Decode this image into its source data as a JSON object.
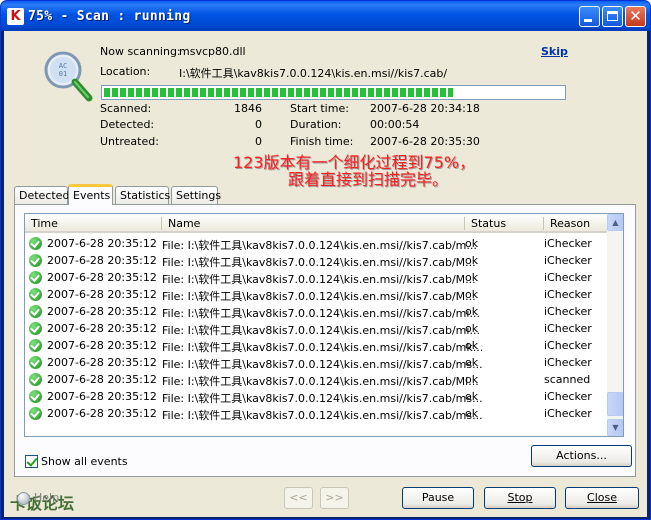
{
  "window": {
    "title": "75% - Scan : running",
    "title_icon_letter": "K"
  },
  "scan": {
    "now_scanning_label": "Now scanning:",
    "now_scanning_value": "msvcp80.dll",
    "location_label": "Location:",
    "location_value": "I:\\软件工具\\kav8kis7.0.0.124\\kis.en.msi//kis7.cab/",
    "skip_label": "Skip",
    "progress_fraction": 0.76,
    "stats": {
      "scanned_label": "Scanned:",
      "scanned_value": "1846",
      "detected_label": "Detected:",
      "detected_value": "0",
      "untreated_label": "Untreated:",
      "untreated_value": "0",
      "start_label": "Start time:",
      "start_value": "2007-6-28 20:34:18",
      "duration_label": "Duration:",
      "duration_value": "00:00:54",
      "finish_label": "Finish time:",
      "finish_value": "2007-6-28 20:35:30"
    },
    "annotation_line1": "123版本有一个细化过程到75%，",
    "annotation_line2": "跟着直接到扫描完毕。"
  },
  "tabs": [
    "Detected",
    "Events",
    "Statistics",
    "Settings"
  ],
  "active_tab": "Events",
  "events": {
    "columns": [
      "Time",
      "Name",
      "Status",
      "Reason"
    ],
    "rows": [
      {
        "time": "2007-6-28 20:35:12",
        "name": "File: I:\\软件工具\\kav8kis7.0.0.124\\kis.en.msi//kis7.cab/m...",
        "status": "ok",
        "reason": "iChecker"
      },
      {
        "time": "2007-6-28 20:35:12",
        "name": "File: I:\\软件工具\\kav8kis7.0.0.124\\kis.en.msi//kis7.cab/M...",
        "status": "ok",
        "reason": "iChecker"
      },
      {
        "time": "2007-6-28 20:35:12",
        "name": "File: I:\\软件工具\\kav8kis7.0.0.124\\kis.en.msi//kis7.cab/M...",
        "status": "ok",
        "reason": "iChecker"
      },
      {
        "time": "2007-6-28 20:35:12",
        "name": "File: I:\\软件工具\\kav8kis7.0.0.124\\kis.en.msi//kis7.cab/M...",
        "status": "ok",
        "reason": "iChecker"
      },
      {
        "time": "2007-6-28 20:35:12",
        "name": "File: I:\\软件工具\\kav8kis7.0.0.124\\kis.en.msi//kis7.cab/mi...",
        "status": "ok",
        "reason": "iChecker"
      },
      {
        "time": "2007-6-28 20:35:12",
        "name": "File: I:\\软件工具\\kav8kis7.0.0.124\\kis.en.msi//kis7.cab/mi...",
        "status": "ok",
        "reason": "iChecker"
      },
      {
        "time": "2007-6-28 20:35:12",
        "name": "File: I:\\软件工具\\kav8kis7.0.0.124\\kis.en.msi//kis7.cab/mk...",
        "status": "ok",
        "reason": "iChecker"
      },
      {
        "time": "2007-6-28 20:35:12",
        "name": "File: I:\\软件工具\\kav8kis7.0.0.124\\kis.en.msi//kis7.cab/ms...",
        "status": "ok",
        "reason": "iChecker"
      },
      {
        "time": "2007-6-28 20:35:12",
        "name": "File: I:\\软件工具\\kav8kis7.0.0.124\\kis.en.msi//kis7.cab/Mi...",
        "status": "ok",
        "reason": "scanned"
      },
      {
        "time": "2007-6-28 20:35:12",
        "name": "File: I:\\软件工具\\kav8kis7.0.0.124\\kis.en.msi//kis7.cab/ms...",
        "status": "ok",
        "reason": "iChecker"
      },
      {
        "time": "2007-6-28 20:35:12",
        "name": "File: I:\\软件工具\\kav8kis7.0.0.124\\kis.en.msi//kis7.cab/ms...",
        "status": "ok",
        "reason": "iChecker"
      }
    ]
  },
  "show_all_events_label": "Show all events",
  "buttons": {
    "actions": "Actions...",
    "back": "<<",
    "forward": ">>",
    "pause": "Pause",
    "stop": "Stop",
    "close": "Close"
  },
  "help_label": "Help",
  "watermark": "卡饭论坛"
}
